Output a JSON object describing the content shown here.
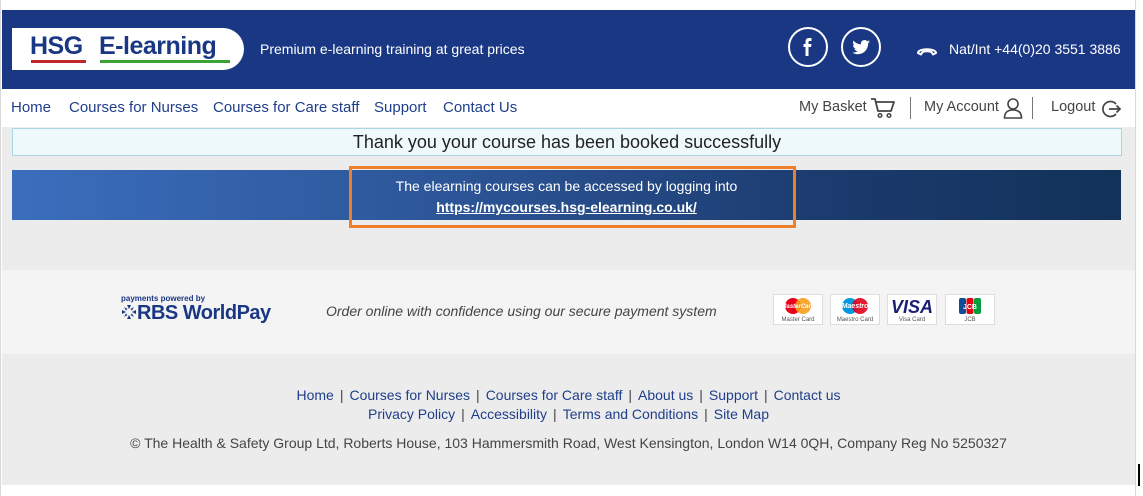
{
  "header": {
    "logo_hsg": "HSG",
    "logo_elearning": "E-learning",
    "tagline": "Premium e-learning training at great prices",
    "facebook_icon": "facebook-icon",
    "twitter_icon": "twitter-icon",
    "phone": "Nat/Int +44(0)20 3551 3886"
  },
  "nav": {
    "items": [
      "Home",
      "Courses for Nurses",
      "Courses for Care staff",
      "Support",
      "Contact Us"
    ],
    "basket": "My Basket",
    "account": "My Account",
    "logout": "Logout"
  },
  "main": {
    "success_message": "Thank you your course has been booked successfully",
    "access_text": "The elearning courses can be accessed by logging into",
    "access_link": "https://mycourses.hsg-elearning.co.uk/"
  },
  "payment": {
    "powered_by": "payments powered by",
    "provider": "RBS WorldPay",
    "secure_text": "Order online with confidence using our secure payment system",
    "cards": [
      {
        "name": "MasterCard",
        "label": "Master Card"
      },
      {
        "name": "Maestro",
        "label": "Maestro Card"
      },
      {
        "name": "VISA",
        "label": "Visa Card"
      },
      {
        "name": "JCB",
        "label": "JCB"
      }
    ]
  },
  "footer": {
    "links_row1": [
      "Home",
      "Courses for Nurses",
      "Courses for Care staff",
      "About us",
      "Support",
      "Contact us"
    ],
    "links_row2": [
      "Privacy Policy",
      "Accessibility",
      "Terms and Conditions",
      "Site Map"
    ],
    "copyright": "© The Health & Safety Group Ltd, Roberts House, 103 Hammersmith Road, West Kensington, London W14 0QH, Company Reg No 5250327"
  },
  "colors": {
    "header_blue": "#1a3784",
    "link_blue": "#1f3e8a",
    "highlight_orange": "#f07f2a"
  }
}
